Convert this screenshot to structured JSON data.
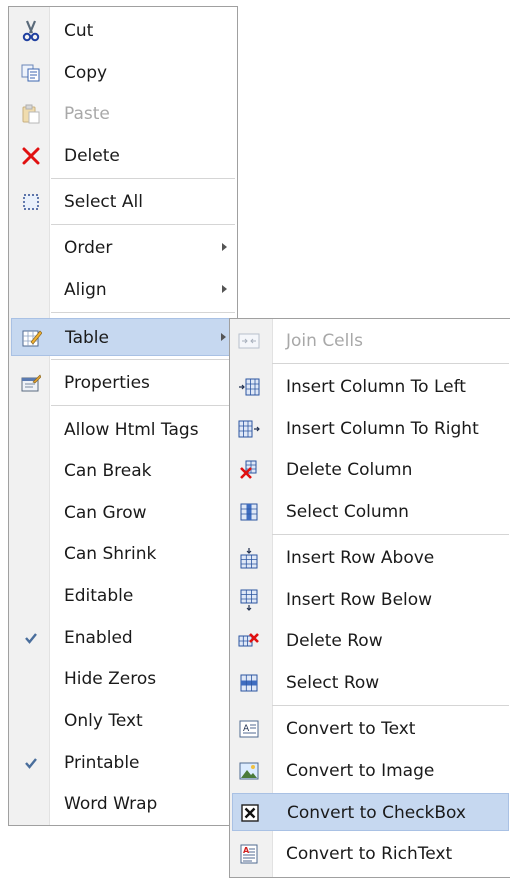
{
  "main_menu": {
    "cut": "Cut",
    "copy": "Copy",
    "paste": "Paste",
    "delete": "Delete",
    "select_all": "Select All",
    "order": "Order",
    "align": "Align",
    "table": "Table",
    "properties": "Properties",
    "allow_html_tags": "Allow Html Tags",
    "can_break": "Can Break",
    "can_grow": "Can Grow",
    "can_shrink": "Can Shrink",
    "editable": "Editable",
    "enabled": "Enabled",
    "hide_zeros": "Hide Zeros",
    "only_text": "Only Text",
    "printable": "Printable",
    "word_wrap": "Word Wrap"
  },
  "table_submenu": {
    "join_cells": "Join Cells",
    "insert_column_left": "Insert Column To Left",
    "insert_column_right": "Insert Column To Right",
    "delete_column": "Delete Column",
    "select_column": "Select Column",
    "insert_row_above": "Insert Row Above",
    "insert_row_below": "Insert Row Below",
    "delete_row": "Delete Row",
    "select_row": "Select Row",
    "convert_text": "Convert to Text",
    "convert_image": "Convert to Image",
    "convert_checkbox": "Convert to CheckBox",
    "convert_richtext": "Convert to RichText"
  },
  "state": {
    "enabled_checked": true,
    "printable_checked": true,
    "open_submenu": "Table",
    "highlighted_submenu_item": "Convert to CheckBox",
    "disabled_items": [
      "Paste",
      "Join Cells"
    ]
  },
  "colors": {
    "highlight": "#c6d8f0",
    "gutter": "#f1f1f1",
    "disabled_text": "#a8a8a8",
    "delete_red": "#e01010",
    "checkmark": "#4a6e9c"
  }
}
